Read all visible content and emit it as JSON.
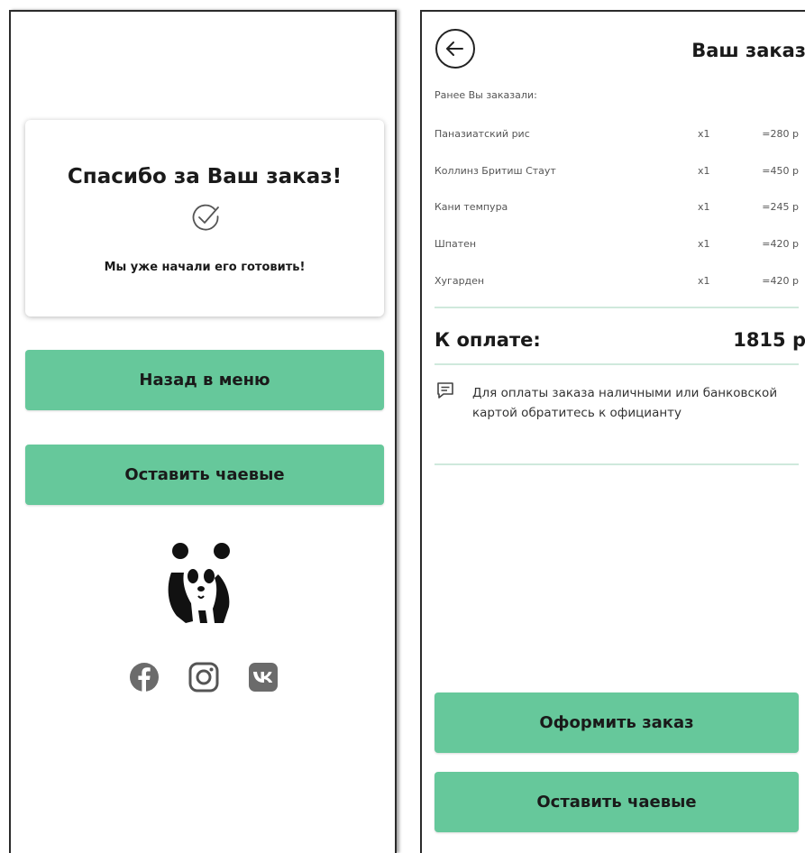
{
  "thanks_screen": {
    "title": "Спасибо за Ваш заказ!",
    "subtitle": "Мы уже начали его готовить!",
    "check_icon": "checkmark-circle-icon",
    "back_button": "Назад в меню",
    "tips_button": "Оставить чаевые",
    "logo": "panda-logo",
    "social_icons": [
      "facebook-icon",
      "instagram-icon",
      "vk-icon"
    ]
  },
  "order_screen": {
    "back_icon": "arrow-left-circle-icon",
    "title": "Ваш заказ",
    "previously_ordered": "Ранее Вы заказали:",
    "items": [
      {
        "name": "Паназиатский рис",
        "qty": "x1",
        "price": "=280 р"
      },
      {
        "name": "Коллинз Бритиш Стаут",
        "qty": "x1",
        "price": "=450 р"
      },
      {
        "name": "Кани темпура",
        "qty": "x1",
        "price": "=245 р"
      },
      {
        "name": "Шпатен",
        "qty": "x1",
        "price": "=420 р"
      },
      {
        "name": "Хугарден",
        "qty": "x1",
        "price": "=420 р"
      }
    ],
    "total_label": "К оплате:",
    "total_value": "1815 р",
    "payment_note": "Для оплаты заказа наличными или банковской картой обратитесь к официанту",
    "checkout_button": "Оформить заказ",
    "tips_button": "Оставить чаевые"
  },
  "colors": {
    "accent_green": "#66c89b",
    "divider_green": "#cfe9dc",
    "text_dark": "#1a1a1a"
  }
}
